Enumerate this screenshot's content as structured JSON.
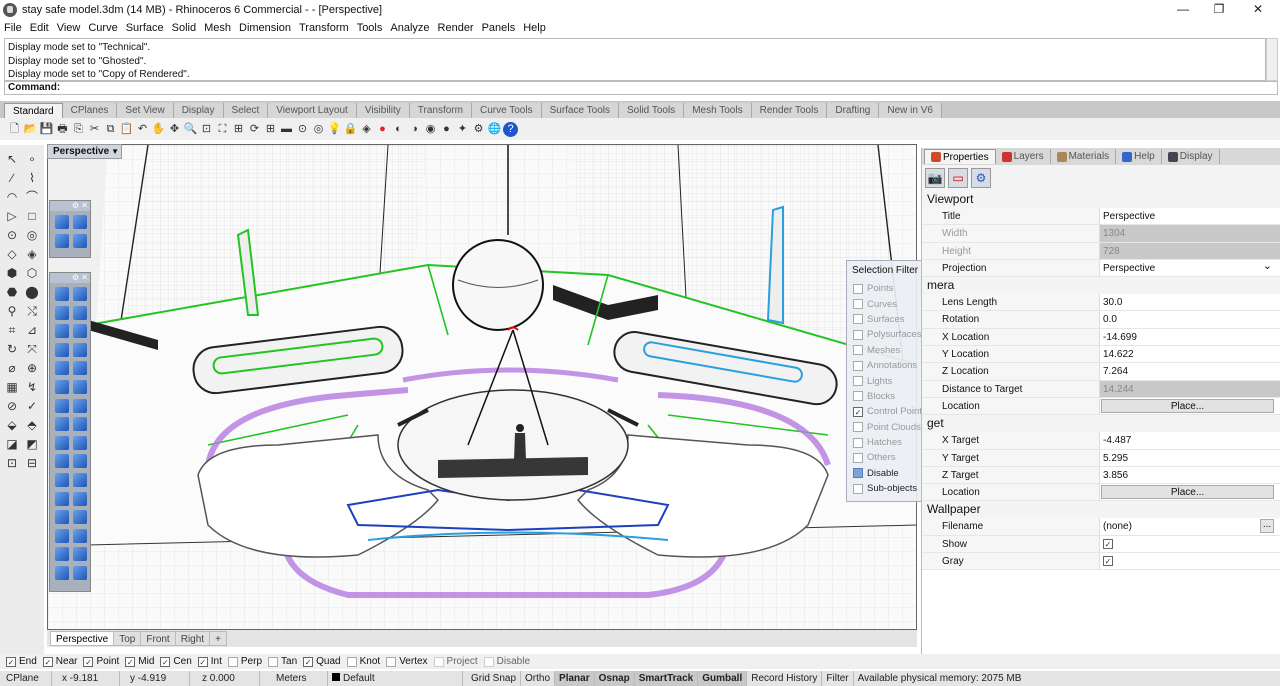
{
  "window": {
    "title": "stay safe model.3dm (14 MB) - Rhinoceros 6 Commercial - - [Perspective]",
    "minimize": "—",
    "maximize": "❐",
    "close": "✕"
  },
  "menu": [
    "File",
    "Edit",
    "View",
    "Curve",
    "Surface",
    "Solid",
    "Mesh",
    "Dimension",
    "Transform",
    "Tools",
    "Analyze",
    "Render",
    "Panels",
    "Help"
  ],
  "command_history": [
    "Display mode set to \"Technical\".",
    "Display mode set to \"Ghosted\".",
    "Display mode set to \"Copy of Rendered\"."
  ],
  "command_prompt": "Command:",
  "toolbar_tabs": [
    "Standard",
    "CPlanes",
    "Set View",
    "Display",
    "Select",
    "Viewport Layout",
    "Visibility",
    "Transform",
    "Curve Tools",
    "Surface Tools",
    "Solid Tools",
    "Mesh Tools",
    "Render Tools",
    "Drafting",
    "New in V6"
  ],
  "viewport": {
    "label": "Perspective",
    "tabs": [
      "Perspective",
      "Top",
      "Front",
      "Right"
    ],
    "add_tab": "+"
  },
  "selection_filter": {
    "title": "Selection Filter",
    "items": [
      {
        "label": "Points",
        "checked": false,
        "enabled": false
      },
      {
        "label": "Curves",
        "checked": false,
        "enabled": false
      },
      {
        "label": "Surfaces",
        "checked": false,
        "enabled": false
      },
      {
        "label": "Polysurfaces",
        "checked": false,
        "enabled": false
      },
      {
        "label": "Meshes",
        "checked": false,
        "enabled": false
      },
      {
        "label": "Annotations",
        "checked": false,
        "enabled": false
      },
      {
        "label": "Lights",
        "checked": false,
        "enabled": false
      },
      {
        "label": "Blocks",
        "checked": false,
        "enabled": false
      },
      {
        "label": "Control Points",
        "checked": true,
        "enabled": false
      },
      {
        "label": "Point Clouds",
        "checked": false,
        "enabled": false
      },
      {
        "label": "Hatches",
        "checked": false,
        "enabled": false
      },
      {
        "label": "Others",
        "checked": false,
        "enabled": false
      },
      {
        "label": "Disable",
        "checked": false,
        "enabled": true
      },
      {
        "label": "Sub-objects",
        "checked": false,
        "enabled": true
      }
    ]
  },
  "panel": {
    "tabs": [
      "Properties",
      "Layers",
      "Materials",
      "Help",
      "Display"
    ],
    "viewport_header": "Viewport",
    "viewport_rows": [
      {
        "k": "Title",
        "v": "Perspective",
        "dis": false
      },
      {
        "k": "Width",
        "v": "1304",
        "dis": true
      },
      {
        "k": "Height",
        "v": "728",
        "dis": true
      },
      {
        "k": "Projection",
        "v": "Perspective",
        "dis": false
      }
    ],
    "camera_header": "mera",
    "camera_rows": [
      {
        "k": "Lens Length",
        "v": "30.0"
      },
      {
        "k": "Rotation",
        "v": "0.0"
      },
      {
        "k": "X Location",
        "v": "-14.699"
      },
      {
        "k": "Y Location",
        "v": "14.622"
      },
      {
        "k": "Z Location",
        "v": "7.264"
      },
      {
        "k": "Distance to Target",
        "v": "14.244"
      }
    ],
    "location_label": "Location",
    "place_label": "Place...",
    "target_header": "get",
    "target_rows": [
      {
        "k": "X Target",
        "v": "-4.487"
      },
      {
        "k": "Y Target",
        "v": "5.295"
      },
      {
        "k": "Z Target",
        "v": "3.856"
      }
    ],
    "wallpaper_header": "Wallpaper",
    "filename_label": "Filename",
    "filename_value": "(none)",
    "filename_btn": "...",
    "show_label": "Show",
    "gray_label": "Gray"
  },
  "snaps": [
    {
      "label": "End",
      "checked": true
    },
    {
      "label": "Near",
      "checked": true
    },
    {
      "label": "Point",
      "checked": true
    },
    {
      "label": "Mid",
      "checked": true
    },
    {
      "label": "Cen",
      "checked": true
    },
    {
      "label": "Int",
      "checked": true
    },
    {
      "label": "Perp",
      "checked": false
    },
    {
      "label": "Tan",
      "checked": false
    },
    {
      "label": "Quad",
      "checked": true
    },
    {
      "label": "Knot",
      "checked": false
    },
    {
      "label": "Vertex",
      "checked": false
    },
    {
      "label": "Project",
      "checked": false
    },
    {
      "label": "Disable",
      "checked": false
    }
  ],
  "status": {
    "cplane": "CPlane",
    "x": "x -9.181",
    "y": "y -4.919",
    "z": "z 0.000",
    "units": "Meters",
    "layer": "Default",
    "grid_snap": "Grid Snap",
    "ortho": "Ortho",
    "planar": "Planar",
    "osnap": "Osnap",
    "smarttrack": "SmartTrack",
    "gumball": "Gumball",
    "record_history": "Record History",
    "filter": "Filter",
    "memory": "Available physical memory: 2075 MB"
  },
  "colors": {
    "accent_green": "#22c422",
    "accent_purple": "#b57be0",
    "accent_blue": "#2a9fe0"
  }
}
